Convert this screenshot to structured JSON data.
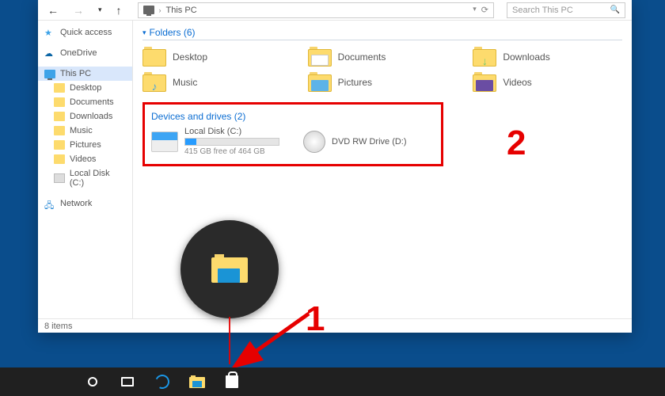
{
  "breadcrumb": {
    "location": "This PC"
  },
  "search": {
    "placeholder": "Search This PC"
  },
  "sidebar": {
    "items": [
      {
        "label": "Quick access",
        "icon": "star",
        "color": "#3ea3e8"
      },
      {
        "label": "OneDrive",
        "icon": "cloud",
        "color": "#0a64a4"
      },
      {
        "label": "This PC",
        "icon": "pc",
        "color": "#3ea3e8",
        "selected": true
      },
      {
        "label": "Desktop",
        "icon": "folder",
        "color": "#fddb6d",
        "indent": true
      },
      {
        "label": "Documents",
        "icon": "folder",
        "color": "#fddb6d",
        "indent": true
      },
      {
        "label": "Downloads",
        "icon": "folder",
        "color": "#fddb6d",
        "indent": true
      },
      {
        "label": "Music",
        "icon": "folder",
        "color": "#fddb6d",
        "indent": true
      },
      {
        "label": "Pictures",
        "icon": "folder",
        "color": "#fddb6d",
        "indent": true
      },
      {
        "label": "Videos",
        "icon": "folder",
        "color": "#fddb6d",
        "indent": true
      },
      {
        "label": "Local Disk (C:)",
        "icon": "drive",
        "color": "#bbb",
        "indent": true
      },
      {
        "label": "Network",
        "icon": "network",
        "color": "#2d8bd6"
      }
    ]
  },
  "groups": {
    "folders": {
      "header": "Folders (6)",
      "items": [
        {
          "label": "Desktop",
          "accent": "#f7d46c"
        },
        {
          "label": "Documents",
          "accent": "#f2f2f2"
        },
        {
          "label": "Downloads",
          "accent": "#6fc96f"
        },
        {
          "label": "Music",
          "accent": "#4aa3df"
        },
        {
          "label": "Pictures",
          "accent": "#5db3e8"
        },
        {
          "label": "Videos",
          "accent": "#6a4da3"
        }
      ]
    },
    "drives": {
      "header": "Devices and drives (2)",
      "items": [
        {
          "label": "Local Disk (C:)",
          "meta": "415 GB free of 464 GB",
          "kind": "hdd",
          "fill_pct": 12
        },
        {
          "label": "DVD RW Drive (D:)",
          "kind": "dvd"
        }
      ]
    }
  },
  "status": {
    "items": "8 items"
  },
  "annotations": {
    "num1": "1",
    "num2": "2"
  }
}
